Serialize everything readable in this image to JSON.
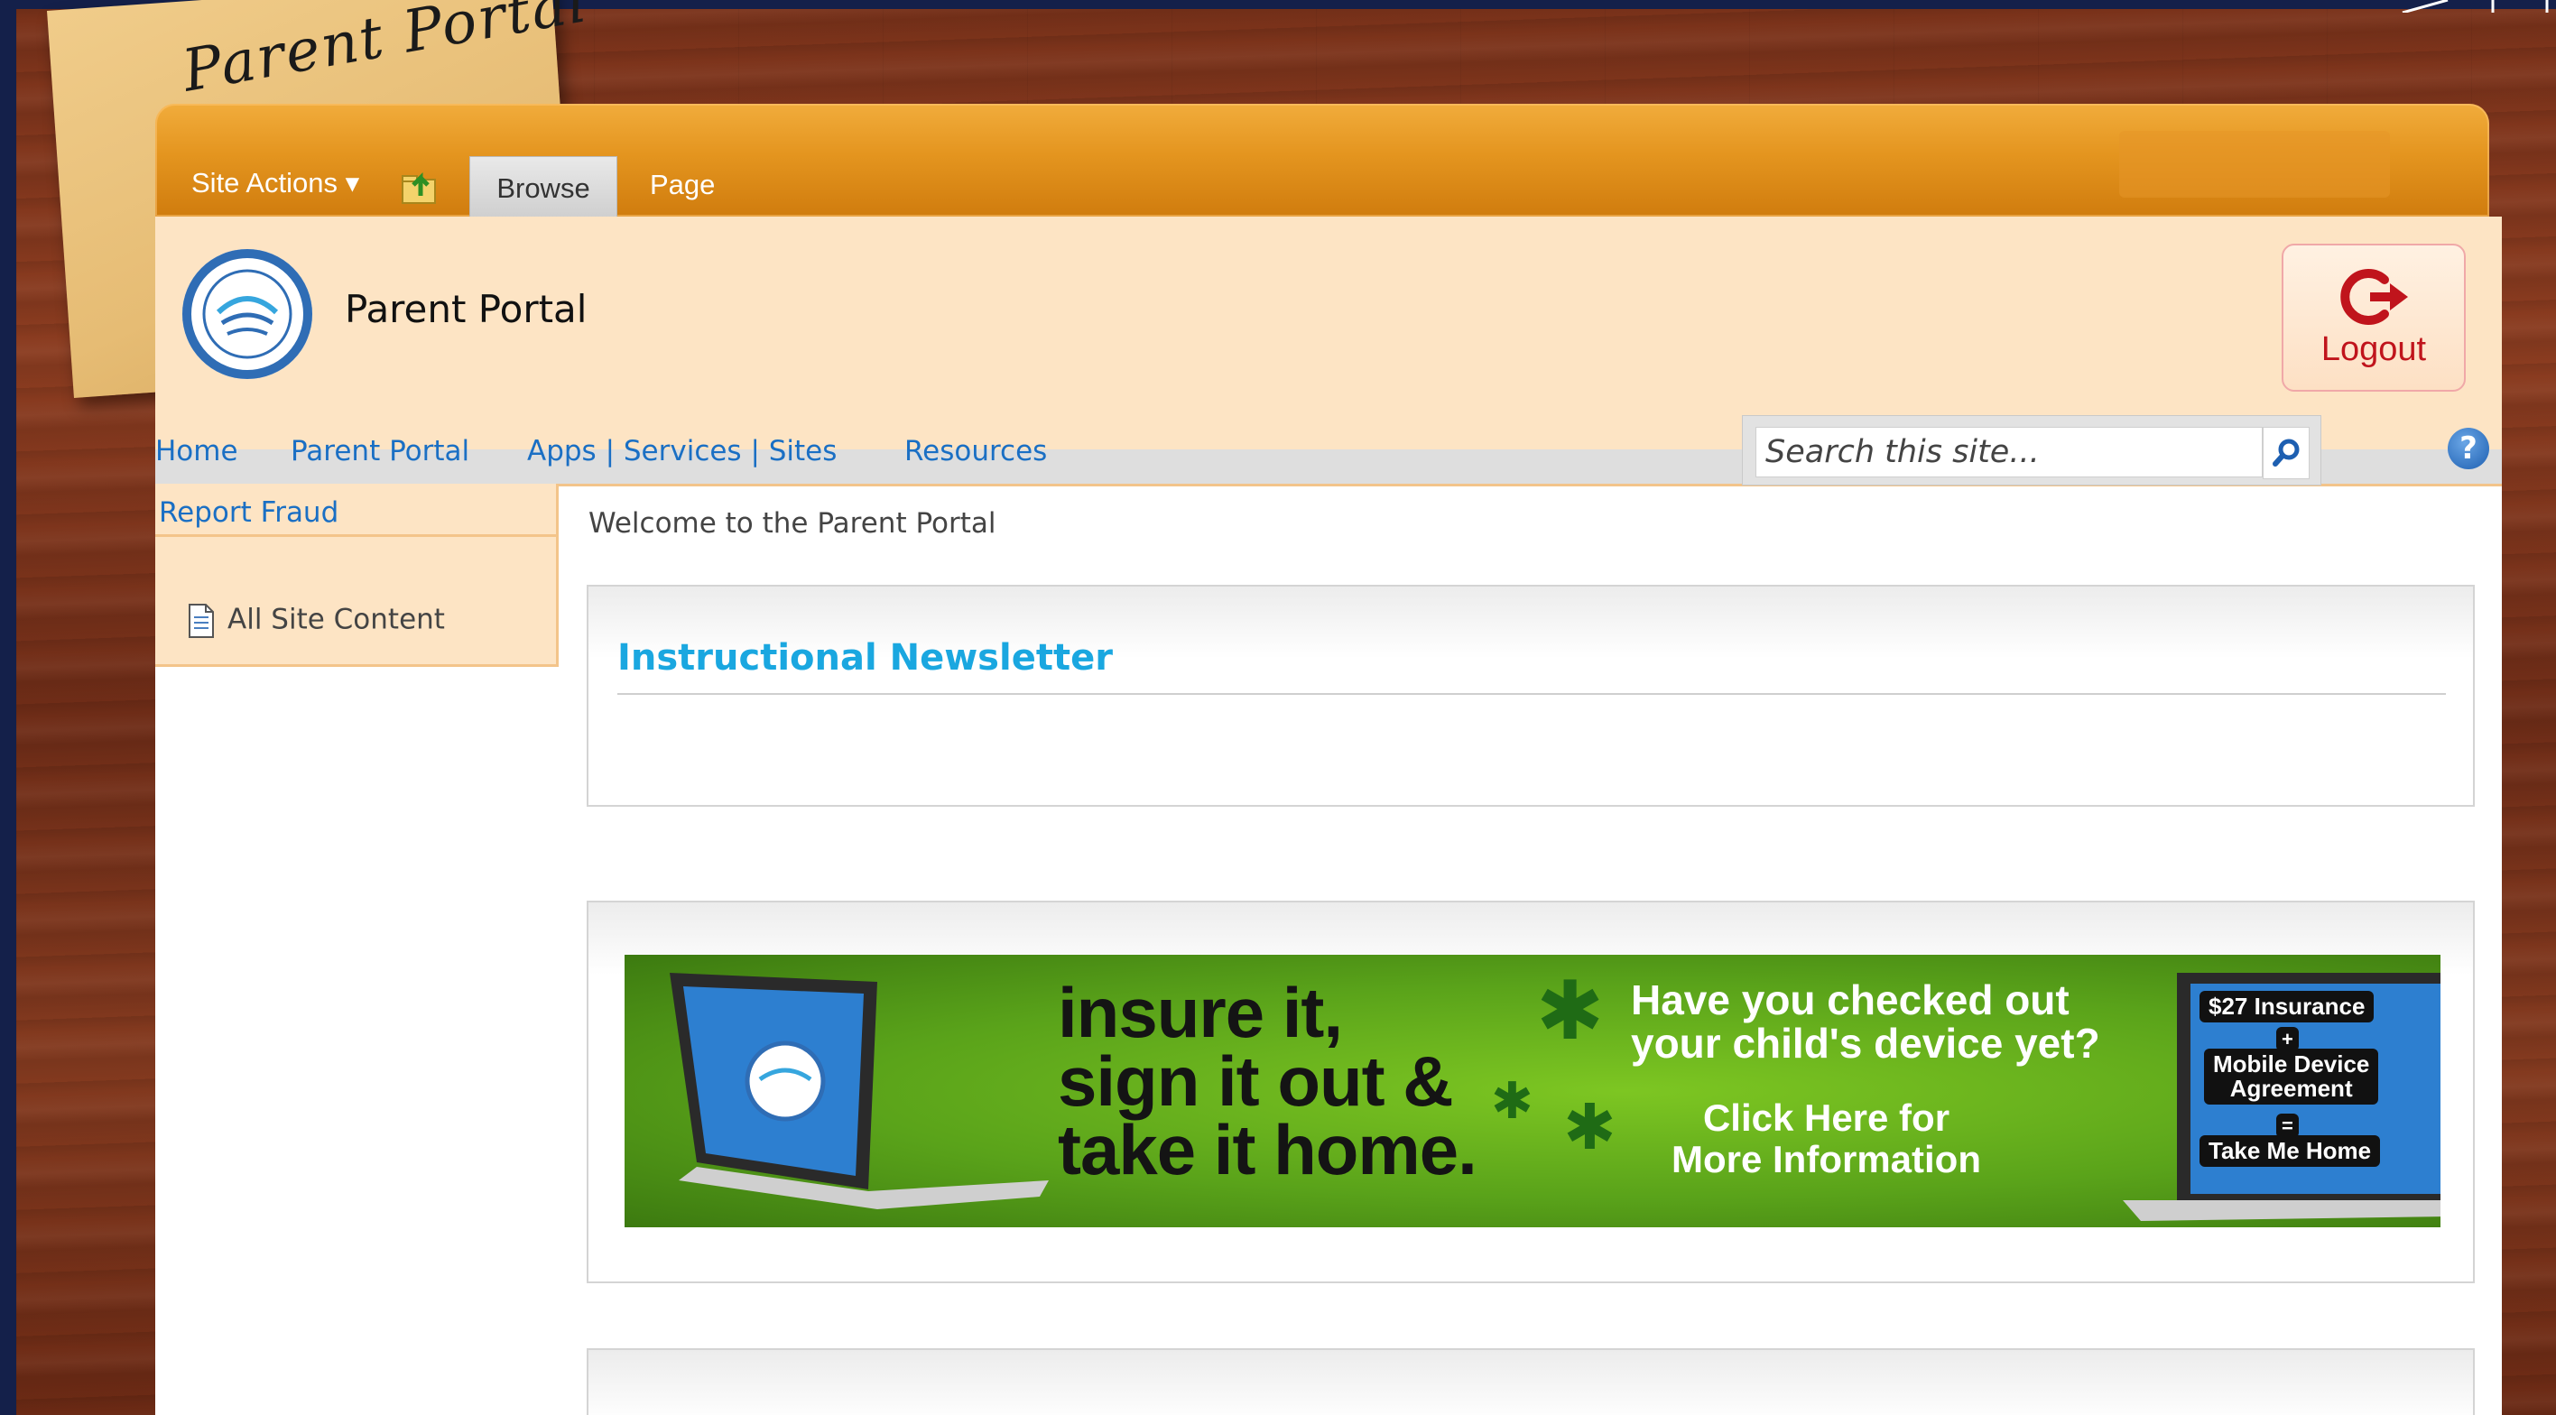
{
  "sticky_note": {
    "title": "Parent Portal"
  },
  "ribbon": {
    "site_actions_label": "Site Actions ▾",
    "tabs": [
      {
        "label": "Browse",
        "active": true
      },
      {
        "label": "Page",
        "active": false
      }
    ]
  },
  "header": {
    "title": "Parent Portal",
    "logout_label": "Logout"
  },
  "topnav": {
    "items": [
      "Home",
      "Parent Portal",
      "Apps | Services | Sites",
      "Resources"
    ]
  },
  "search": {
    "placeholder": "Search this site..."
  },
  "help": {
    "label": "?"
  },
  "leftnav": {
    "report_fraud": "Report Fraud",
    "all_site_content": "All Site Content"
  },
  "main": {
    "welcome": "Welcome to the Parent Portal",
    "newsletter_title": "Instructional Newsletter",
    "banner": {
      "headline_1": "insure it,",
      "headline_2": "sign it out &",
      "headline_3": "take it home.",
      "question_1": "Have you checked out",
      "question_2": "your child's device yet?",
      "cta_1": "Click Here for",
      "cta_2": "More Information",
      "label_insurance": "$27 Insurance",
      "label_plus": "+",
      "label_agreement_1": "Mobile Device",
      "label_agreement_2": "Agreement",
      "label_equals": "=",
      "label_take_home": "Take Me Home"
    }
  },
  "colors": {
    "accent_orange": "#e4951f",
    "header_bg": "#fde4c4",
    "link_blue": "#1a6fc4",
    "newsletter_blue": "#1aa7e0",
    "logout_red": "#c0141c"
  }
}
